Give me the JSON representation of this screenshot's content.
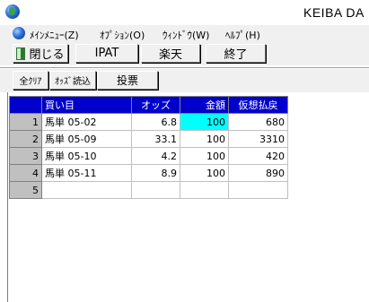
{
  "window": {
    "title": "KEIBA DA"
  },
  "menu": {
    "items": [
      {
        "label": "ﾒｲﾝﾒﾆｭｰ(Z)"
      },
      {
        "label": "ｵﾌﾟｼｮﾝ(O)"
      },
      {
        "label": "ｳｨﾝﾄﾞｳ(W)"
      },
      {
        "label": "ﾍﾙﾌﾟ(H)"
      }
    ]
  },
  "toolbar": {
    "close_label": "閉じる",
    "ipat_label": "IPAT",
    "rakuten_label": "楽天",
    "exit_label": "終了"
  },
  "toolbar2": {
    "clear_label": "全ｸﾘｱ",
    "odds_label": "ｵｯｽﾞ読込",
    "vote_label": "投票"
  },
  "grid": {
    "headers": [
      "買い目",
      "オッズ",
      "金額",
      "仮想払戻"
    ],
    "rows": [
      {
        "no": "1",
        "bet": "馬単 05-02",
        "odds": "6.8",
        "amount": "100",
        "payout": "680"
      },
      {
        "no": "2",
        "bet": "馬単 05-09",
        "odds": "33.1",
        "amount": "100",
        "payout": "3310"
      },
      {
        "no": "3",
        "bet": "馬単 05-10",
        "odds": "4.2",
        "amount": "100",
        "payout": "420"
      },
      {
        "no": "4",
        "bet": "馬単 05-11",
        "odds": "8.9",
        "amount": "100",
        "payout": "890"
      },
      {
        "no": "5",
        "bet": "",
        "odds": "",
        "amount": "",
        "payout": ""
      }
    ]
  },
  "colors": {
    "header_bg": "#0000cc",
    "selected_cell": "#00ffff",
    "row_header_bg": "#c0c0c0"
  }
}
